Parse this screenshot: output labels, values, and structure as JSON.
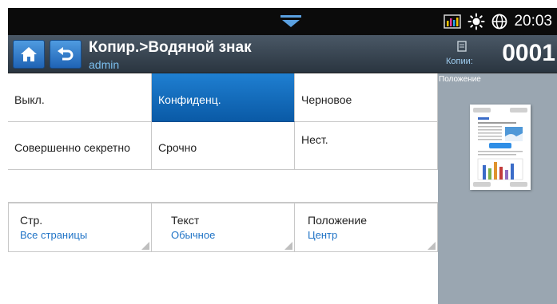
{
  "status_bar": {
    "time": "20:03",
    "icons": [
      "pull-down-tab-icon",
      "signal-bars-icon",
      "sun-icon",
      "globe-icon"
    ]
  },
  "header": {
    "title": "Копир.>Водяной знак",
    "user": "admin",
    "copies_label": "Копии:",
    "copies_value": "0001"
  },
  "watermark_options": [
    {
      "label": "Выкл.",
      "selected": false
    },
    {
      "label": "Конфиденц.",
      "selected": true
    },
    {
      "label": "Черновое",
      "selected": false
    },
    {
      "label": "Совершенно секретно",
      "selected": false
    },
    {
      "label": "Срочно",
      "selected": false
    },
    {
      "label": "Нест.",
      "selected": false
    }
  ],
  "settings": [
    {
      "label": "Стр.",
      "value": "Все страницы"
    },
    {
      "label": "Текст",
      "value": "Обычное"
    },
    {
      "label": "Положение",
      "value": "Центр"
    }
  ],
  "preview": {
    "label": "Положение"
  },
  "colors": {
    "accent_blue": "#1f73c6",
    "selected_blue": "#0a5aa6",
    "header_dark": "#2a3540",
    "preview_bg": "#9aa6b1"
  }
}
